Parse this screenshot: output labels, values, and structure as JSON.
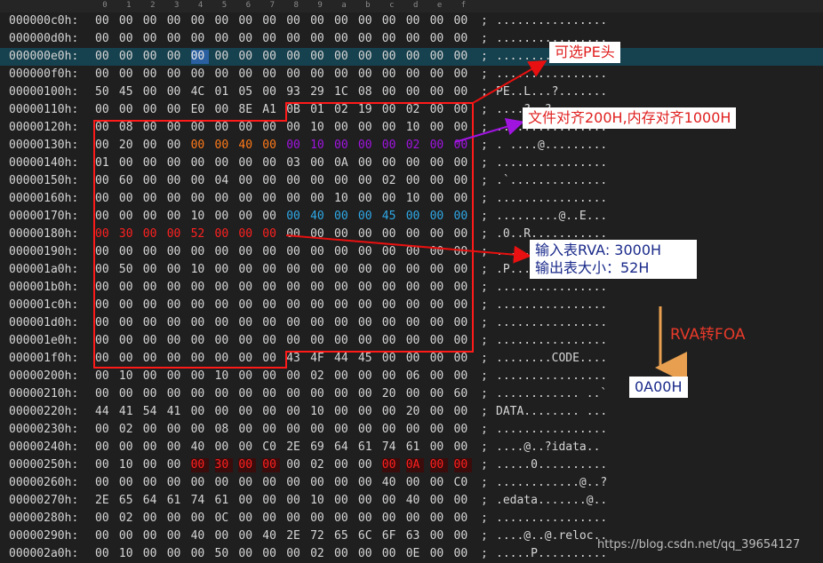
{
  "column_header": [
    "0",
    "1",
    "2",
    "3",
    "4",
    "5",
    "6",
    "7",
    "8",
    "9",
    "a",
    "b",
    "c",
    "d",
    "e",
    "f"
  ],
  "rows": [
    {
      "addr": "000000c0h:",
      "bytes": [
        "00",
        "00",
        "00",
        "00",
        "00",
        "00",
        "00",
        "00",
        "00",
        "00",
        "00",
        "00",
        "00",
        "00",
        "00",
        "00"
      ],
      "ascii": "................"
    },
    {
      "addr": "000000d0h:",
      "bytes": [
        "00",
        "00",
        "00",
        "00",
        "00",
        "00",
        "00",
        "00",
        "00",
        "00",
        "00",
        "00",
        "00",
        "00",
        "00",
        "00"
      ],
      "ascii": "................"
    },
    {
      "addr": "000000e0h:",
      "bytes": [
        "00",
        "00",
        "00",
        "00",
        "00",
        "00",
        "00",
        "00",
        "00",
        "00",
        "00",
        "00",
        "00",
        "00",
        "00",
        "00"
      ],
      "ascii": "................",
      "selected": true
    },
    {
      "addr": "000000f0h:",
      "bytes": [
        "00",
        "00",
        "00",
        "00",
        "00",
        "00",
        "00",
        "00",
        "00",
        "00",
        "00",
        "00",
        "00",
        "00",
        "00",
        "00"
      ],
      "ascii": "................"
    },
    {
      "addr": "00000100h:",
      "bytes": [
        "50",
        "45",
        "00",
        "00",
        "4C",
        "01",
        "05",
        "00",
        "93",
        "29",
        "1C",
        "08",
        "00",
        "00",
        "00",
        "00"
      ],
      "ascii": "PE..L...?......."
    },
    {
      "addr": "00000110h:",
      "bytes": [
        "00",
        "00",
        "00",
        "00",
        "E0",
        "00",
        "8E",
        "A1",
        "0B",
        "01",
        "02",
        "19",
        "00",
        "02",
        "00",
        "00"
      ],
      "ascii": "....?..?........"
    },
    {
      "addr": "00000120h:",
      "bytes": [
        "00",
        "08",
        "00",
        "00",
        "00",
        "00",
        "00",
        "00",
        "00",
        "10",
        "00",
        "00",
        "00",
        "10",
        "00",
        "00"
      ],
      "ascii": "................"
    },
    {
      "addr": "00000130h:",
      "bytes": [
        "00",
        "20",
        "00",
        "00",
        "00",
        "00",
        "40",
        "00",
        "00",
        "10",
        "00",
        "00",
        "00",
        "02",
        "00",
        "00"
      ],
      "ascii": ". ....@........."
    },
    {
      "addr": "00000140h:",
      "bytes": [
        "01",
        "00",
        "00",
        "00",
        "00",
        "00",
        "00",
        "00",
        "03",
        "00",
        "0A",
        "00",
        "00",
        "00",
        "00",
        "00"
      ],
      "ascii": "................"
    },
    {
      "addr": "00000150h:",
      "bytes": [
        "00",
        "60",
        "00",
        "00",
        "00",
        "04",
        "00",
        "00",
        "00",
        "00",
        "00",
        "00",
        "02",
        "00",
        "00",
        "00"
      ],
      "ascii": ".`.............."
    },
    {
      "addr": "00000160h:",
      "bytes": [
        "00",
        "00",
        "00",
        "00",
        "00",
        "00",
        "00",
        "00",
        "00",
        "00",
        "10",
        "00",
        "00",
        "10",
        "00",
        "00"
      ],
      "ascii": "................"
    },
    {
      "addr": "00000170h:",
      "bytes": [
        "00",
        "00",
        "00",
        "00",
        "10",
        "00",
        "00",
        "00",
        "00",
        "40",
        "00",
        "00",
        "45",
        "00",
        "00",
        "00"
      ],
      "ascii": ".........@..E..."
    },
    {
      "addr": "00000180h:",
      "bytes": [
        "00",
        "30",
        "00",
        "00",
        "52",
        "00",
        "00",
        "00",
        "00",
        "00",
        "00",
        "00",
        "00",
        "00",
        "00",
        "00"
      ],
      "ascii": ".0..R..........."
    },
    {
      "addr": "00000190h:",
      "bytes": [
        "00",
        "00",
        "00",
        "00",
        "00",
        "00",
        "00",
        "00",
        "00",
        "00",
        "00",
        "00",
        "00",
        "00",
        "00",
        "00"
      ],
      "ascii": "................"
    },
    {
      "addr": "000001a0h:",
      "bytes": [
        "00",
        "50",
        "00",
        "00",
        "10",
        "00",
        "00",
        "00",
        "00",
        "00",
        "00",
        "00",
        "00",
        "00",
        "00",
        "00"
      ],
      "ascii": ".P.............."
    },
    {
      "addr": "000001b0h:",
      "bytes": [
        "00",
        "00",
        "00",
        "00",
        "00",
        "00",
        "00",
        "00",
        "00",
        "00",
        "00",
        "00",
        "00",
        "00",
        "00",
        "00"
      ],
      "ascii": "................"
    },
    {
      "addr": "000001c0h:",
      "bytes": [
        "00",
        "00",
        "00",
        "00",
        "00",
        "00",
        "00",
        "00",
        "00",
        "00",
        "00",
        "00",
        "00",
        "00",
        "00",
        "00"
      ],
      "ascii": "................"
    },
    {
      "addr": "000001d0h:",
      "bytes": [
        "00",
        "00",
        "00",
        "00",
        "00",
        "00",
        "00",
        "00",
        "00",
        "00",
        "00",
        "00",
        "00",
        "00",
        "00",
        "00"
      ],
      "ascii": "................"
    },
    {
      "addr": "000001e0h:",
      "bytes": [
        "00",
        "00",
        "00",
        "00",
        "00",
        "00",
        "00",
        "00",
        "00",
        "00",
        "00",
        "00",
        "00",
        "00",
        "00",
        "00"
      ],
      "ascii": "................"
    },
    {
      "addr": "000001f0h:",
      "bytes": [
        "00",
        "00",
        "00",
        "00",
        "00",
        "00",
        "00",
        "00",
        "43",
        "4F",
        "44",
        "45",
        "00",
        "00",
        "00",
        "00"
      ],
      "ascii": "........CODE...."
    },
    {
      "addr": "00000200h:",
      "bytes": [
        "00",
        "10",
        "00",
        "00",
        "00",
        "10",
        "00",
        "00",
        "00",
        "02",
        "00",
        "00",
        "00",
        "06",
        "00",
        "00"
      ],
      "ascii": "................"
    },
    {
      "addr": "00000210h:",
      "bytes": [
        "00",
        "00",
        "00",
        "00",
        "00",
        "00",
        "00",
        "00",
        "00",
        "00",
        "00",
        "00",
        "20",
        "00",
        "00",
        "60"
      ],
      "ascii": "............ ..`"
    },
    {
      "addr": "00000220h:",
      "bytes": [
        "44",
        "41",
        "54",
        "41",
        "00",
        "00",
        "00",
        "00",
        "00",
        "10",
        "00",
        "00",
        "00",
        "20",
        "00",
        "00"
      ],
      "ascii": "DATA........ ..."
    },
    {
      "addr": "00000230h:",
      "bytes": [
        "00",
        "02",
        "00",
        "00",
        "00",
        "08",
        "00",
        "00",
        "00",
        "00",
        "00",
        "00",
        "00",
        "00",
        "00",
        "00"
      ],
      "ascii": "................"
    },
    {
      "addr": "00000240h:",
      "bytes": [
        "00",
        "00",
        "00",
        "00",
        "40",
        "00",
        "00",
        "C0",
        "2E",
        "69",
        "64",
        "61",
        "74",
        "61",
        "00",
        "00"
      ],
      "ascii": "....@..?idata.."
    },
    {
      "addr": "00000250h:",
      "bytes": [
        "00",
        "10",
        "00",
        "00",
        "00",
        "30",
        "00",
        "00",
        "00",
        "02",
        "00",
        "00",
        "00",
        "0A",
        "00",
        "00"
      ],
      "ascii": ".....0.........."
    },
    {
      "addr": "00000260h:",
      "bytes": [
        "00",
        "00",
        "00",
        "00",
        "00",
        "00",
        "00",
        "00",
        "00",
        "00",
        "00",
        "00",
        "40",
        "00",
        "00",
        "C0"
      ],
      "ascii": "............@..?"
    },
    {
      "addr": "00000270h:",
      "bytes": [
        "2E",
        "65",
        "64",
        "61",
        "74",
        "61",
        "00",
        "00",
        "00",
        "10",
        "00",
        "00",
        "00",
        "40",
        "00",
        "00"
      ],
      "ascii": ".edata.......@.."
    },
    {
      "addr": "00000280h:",
      "bytes": [
        "00",
        "02",
        "00",
        "00",
        "00",
        "0C",
        "00",
        "00",
        "00",
        "00",
        "00",
        "00",
        "00",
        "00",
        "00",
        "00"
      ],
      "ascii": "................"
    },
    {
      "addr": "00000290h:",
      "bytes": [
        "00",
        "00",
        "00",
        "00",
        "40",
        "00",
        "00",
        "40",
        "2E",
        "72",
        "65",
        "6C",
        "6F",
        "63",
        "00",
        "00"
      ],
      "ascii": "....@..@.reloc.."
    },
    {
      "addr": "000002a0h:",
      "bytes": [
        "00",
        "10",
        "00",
        "00",
        "00",
        "50",
        "00",
        "00",
        "00",
        "02",
        "00",
        "00",
        "00",
        "0E",
        "00",
        "00"
      ],
      "ascii": ".....P.........."
    }
  ],
  "annotations": {
    "optional_pe_header": "可选PE头",
    "alignment": "文件对齐200H,内存对齐1000H",
    "import_rva": "输入表RVA: 3000H",
    "export_size": "输出表大小：52H",
    "rva_to_foa": "RVA转FOA",
    "foa_result": "0A00H"
  },
  "watermark": "https://blog.csdn.net/qq_39654127",
  "colors": {
    "background": "#1f1f1f",
    "selected_row": "#16414e",
    "red": "#ff2020",
    "orange": "#ff7a1a",
    "purple": "#a014e0",
    "cyan": "#2fa8e6",
    "arrow_orange": "#e8a050"
  }
}
